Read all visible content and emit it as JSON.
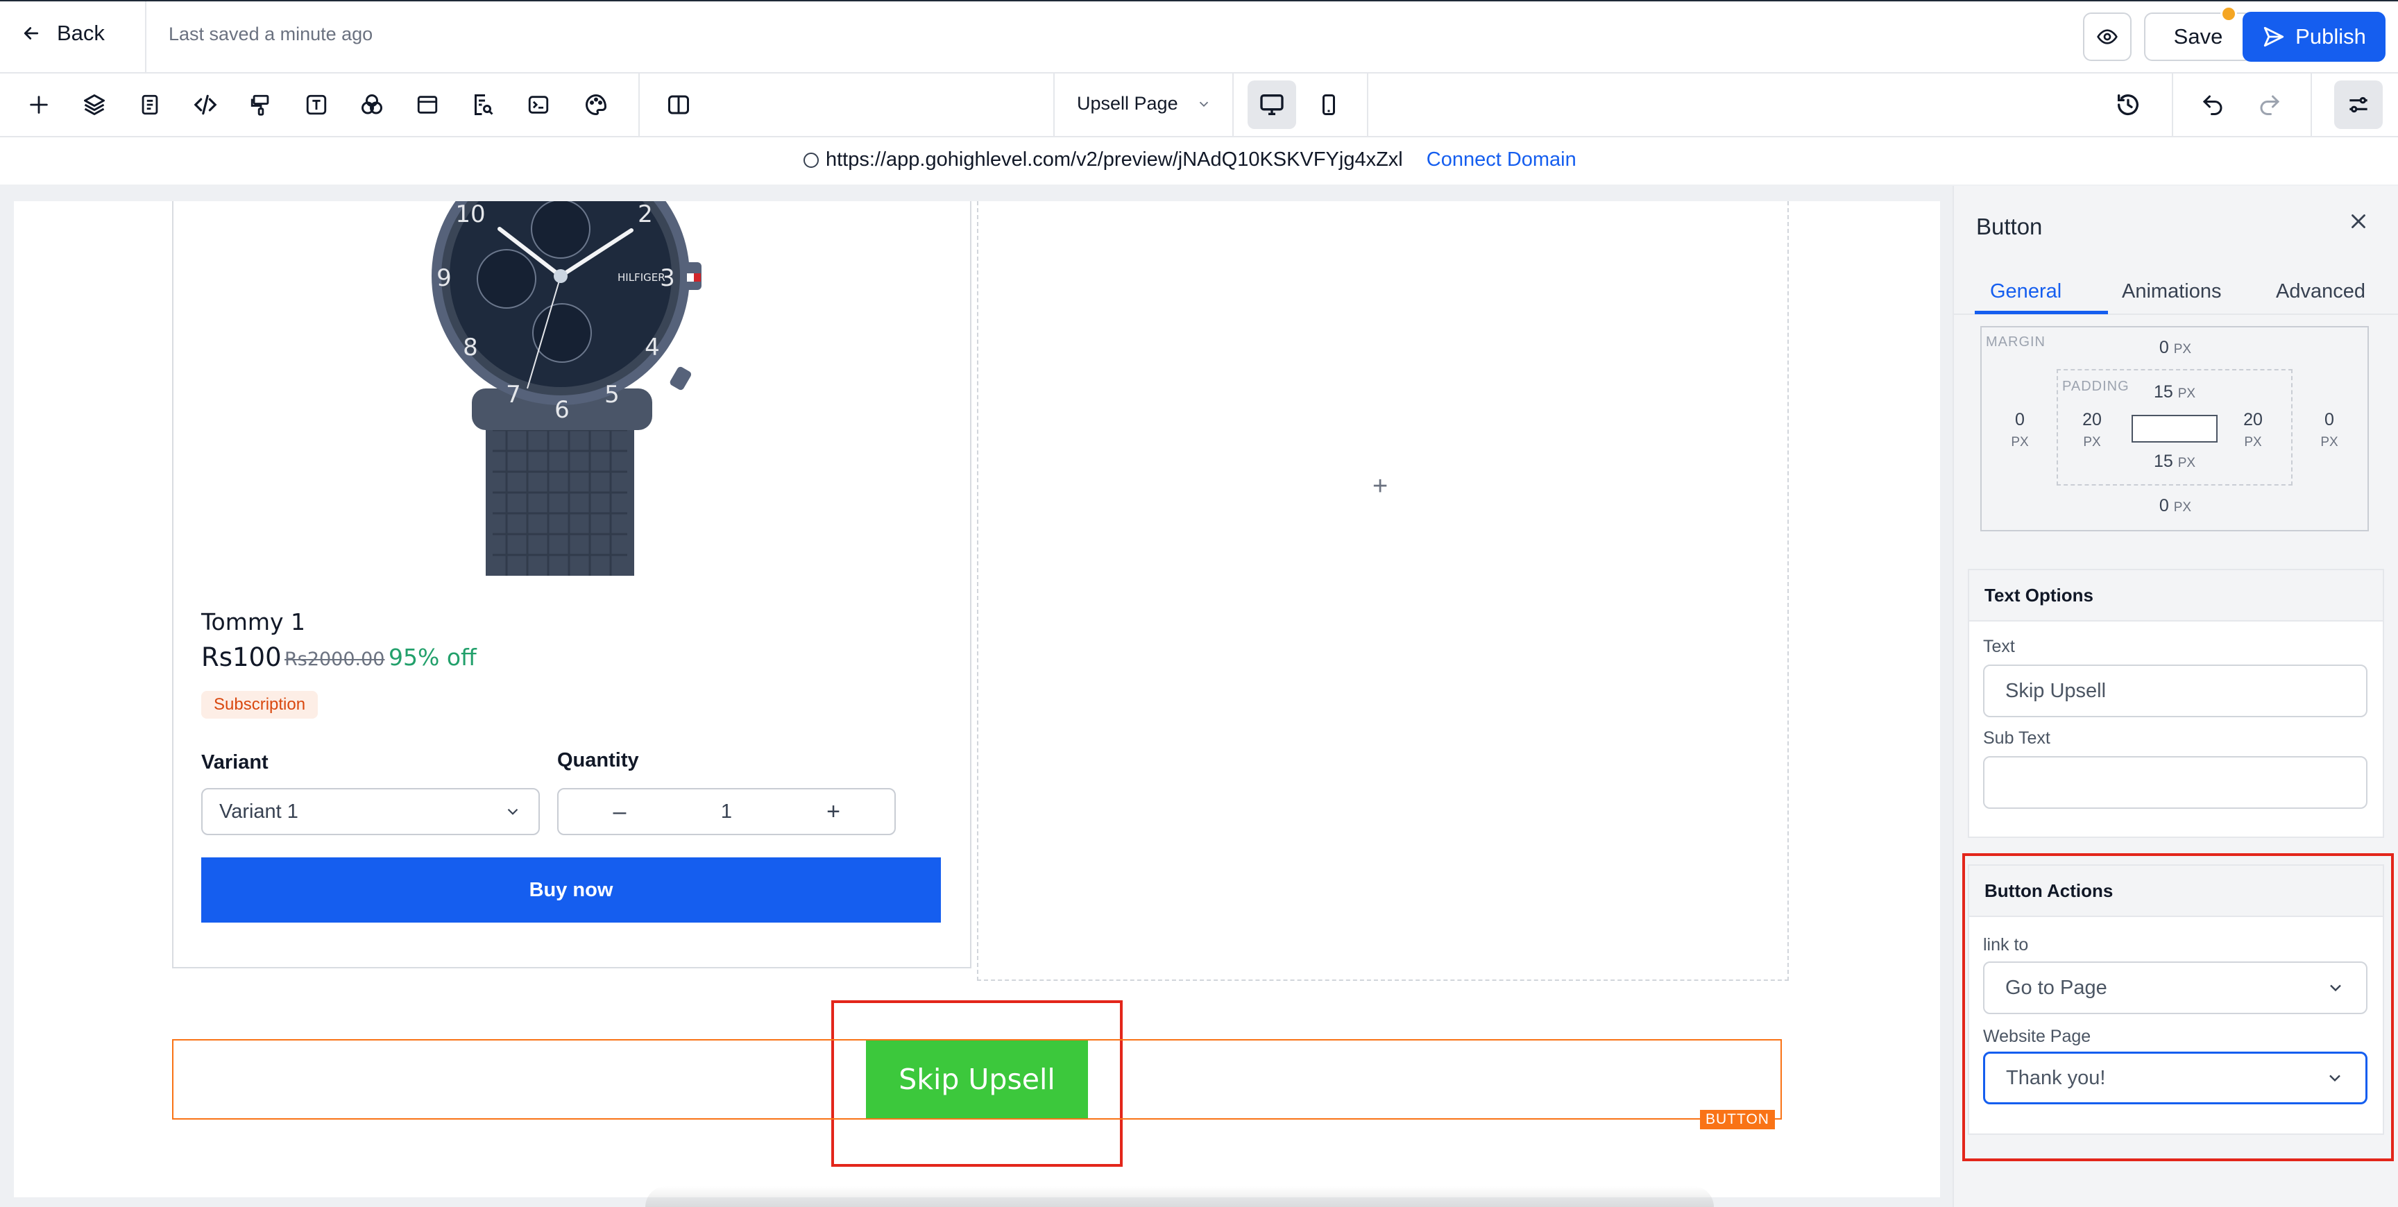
{
  "header": {
    "back_label": "Back",
    "saved_status": "Last saved a minute ago",
    "save_label": "Save",
    "publish_label": "Publish"
  },
  "toolbar": {
    "tools": [
      "add-icon",
      "layers-icon",
      "pages-icon",
      "code-icon",
      "paint-icon",
      "text-icon",
      "elements-icon",
      "section-icon",
      "search-doc-icon",
      "terminal-icon",
      "color-palette-icon",
      "split-view-icon"
    ],
    "page_select": "Upsell Page"
  },
  "urlbar": {
    "url": "https://app.gohighlevel.com/v2/preview/jNAdQ10KSKVFYjg4xZxl",
    "connect_label": "Connect Domain"
  },
  "product": {
    "name": "Tommy 1",
    "price": "Rs100",
    "old_price": "Rs2000.00",
    "discount": "95% off",
    "badge": "Subscription",
    "variant_label": "Variant",
    "variant_value": "Variant 1",
    "quantity_label": "Quantity",
    "quantity_value": "1",
    "minus": "–",
    "plus": "+",
    "buy_label": "Buy now",
    "watch_brand": "HILFIGER"
  },
  "canvas": {
    "empty_plus": "+",
    "skip_button": "Skip Upsell",
    "element_tag": "BUTTON"
  },
  "panel": {
    "title": "Button",
    "tabs": [
      "General",
      "Animations",
      "Advanced"
    ],
    "active_tab": "General",
    "spacing": {
      "margin_label": "MARGIN",
      "padding_label": "PADDING",
      "margin_top": "0",
      "margin_bottom": "0",
      "margin_left": "0",
      "margin_right": "0",
      "padding_top": "15",
      "padding_bottom": "15",
      "padding_left": "20",
      "padding_right": "20",
      "unit": "PX"
    },
    "text_options": {
      "heading": "Text Options",
      "text_label": "Text",
      "text_value": "Skip Upsell",
      "subtext_label": "Sub Text",
      "subtext_value": ""
    },
    "button_actions": {
      "heading": "Button Actions",
      "link_label": "link to",
      "link_value": "Go to Page",
      "page_label": "Website Page",
      "page_value": "Thank you!"
    }
  },
  "colors": {
    "primary": "#155eef",
    "skip_button": "#3cc83c",
    "selection": "#f97316",
    "highlight": "#e3261b",
    "discount": "#22a06b"
  }
}
